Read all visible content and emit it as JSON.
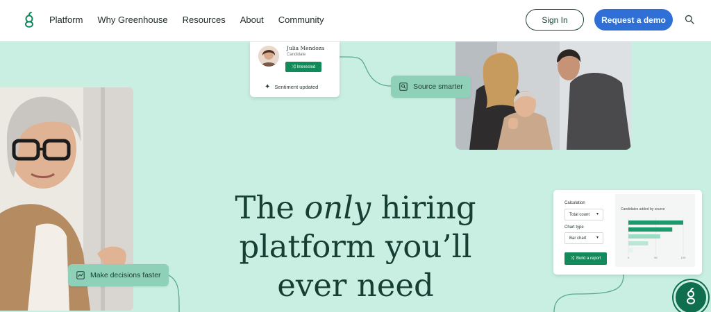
{
  "nav": {
    "items": [
      {
        "label": "Platform"
      },
      {
        "label": "Why Greenhouse"
      },
      {
        "label": "Resources"
      },
      {
        "label": "About"
      },
      {
        "label": "Community"
      }
    ],
    "sign_in": "Sign In",
    "demo": "Request a demo",
    "search_icon": "search-icon",
    "logo_icon": "greenhouse-g-logo"
  },
  "cards": {
    "candidate": {
      "name": "Julia Mendoza",
      "role": "Candidate",
      "tag": "Interested",
      "sentiment": "Sentiment updated"
    },
    "source_pill": "Source smarter",
    "decide_pill": "Make decisions faster",
    "report": {
      "calc_label": "Calculation",
      "calc_value": "Total count",
      "chart_label": "Chart type",
      "chart_value": "Bar chart",
      "button": "Build a report",
      "chart_title": "Candidates added by source",
      "ticks": [
        "0",
        "50",
        "100"
      ]
    }
  },
  "hero": {
    "line1_a": "The ",
    "line1_em": "only",
    "line1_b": " hiring",
    "line2": "platform you’ll",
    "line3": "ever need"
  },
  "colors": {
    "background": "#c9efe3",
    "brand_green": "#138a5a",
    "heading": "#163f34",
    "demo_button": "#2f6fd6"
  },
  "chart_data": {
    "type": "bar",
    "title": "Candidates added by source",
    "categories": [
      "",
      "",
      "",
      "",
      ""
    ],
    "values": [
      100,
      80,
      58,
      36,
      8
    ],
    "xlim": [
      0,
      100
    ],
    "orientation": "horizontal"
  }
}
